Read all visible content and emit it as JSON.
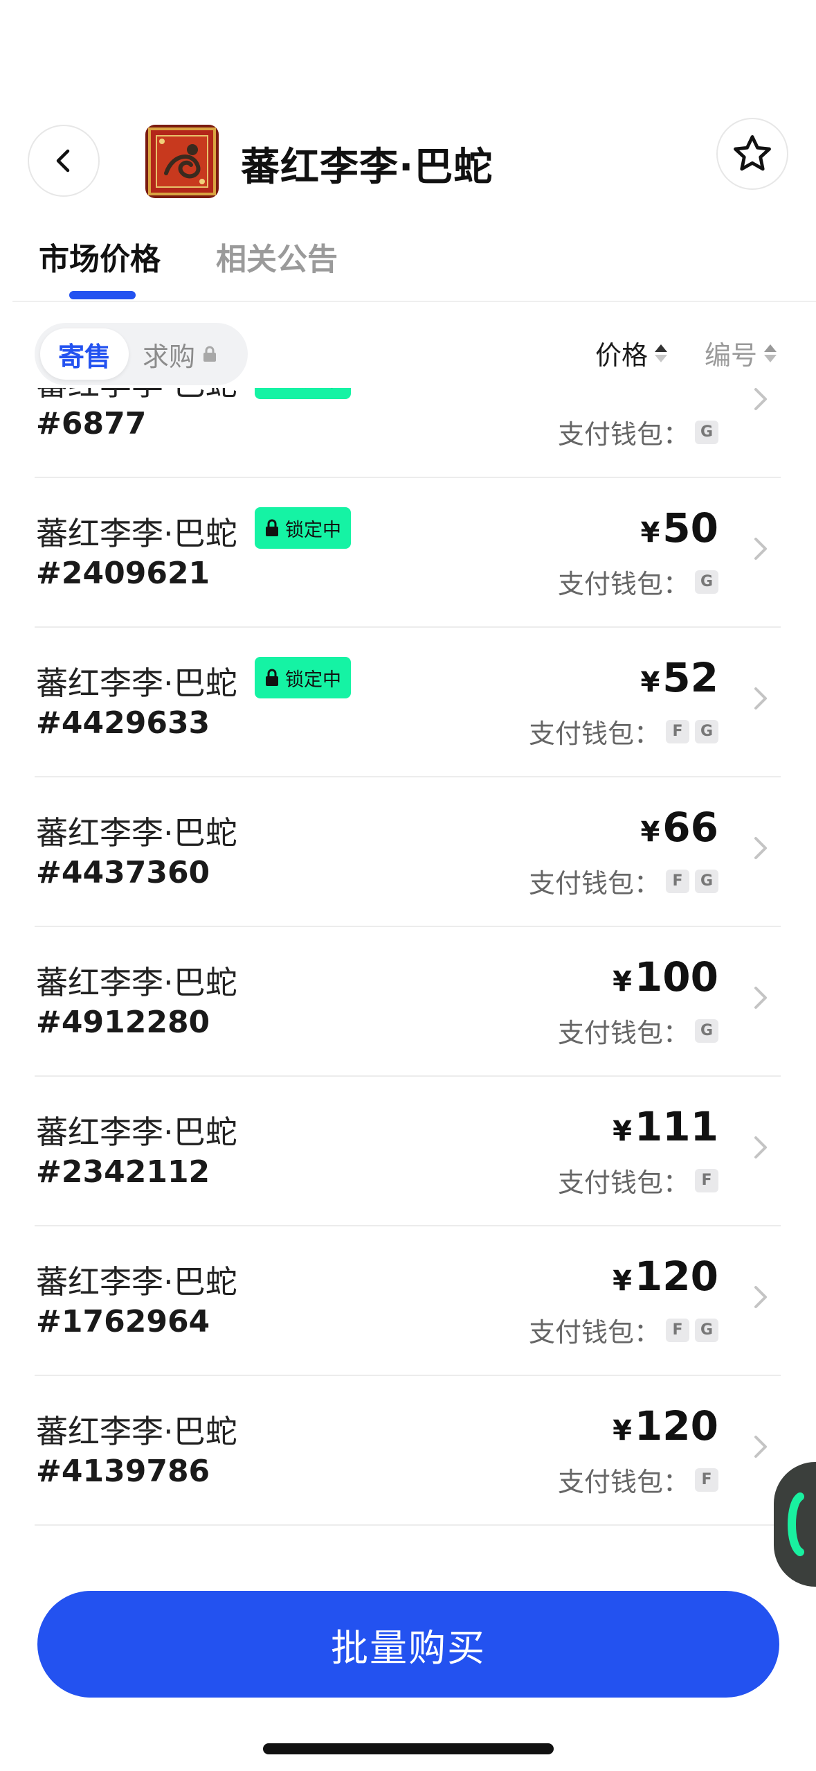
{
  "header": {
    "title": "蕃红李李·巴蛇"
  },
  "tabs": [
    {
      "label": "市场价格",
      "active": true
    },
    {
      "label": "相关公告",
      "active": false
    }
  ],
  "filter": {
    "segment_on": "寄售",
    "segment_off": "求购",
    "sort_price": "价格",
    "sort_number": "编号"
  },
  "wallet_label": "支付钱包：",
  "lock_label": "锁定中",
  "items": [
    {
      "name": "蕃红李李·巴蛇",
      "id": "#6877",
      "price": "",
      "locked": true,
      "wallets": [
        "G"
      ]
    },
    {
      "name": "蕃红李李·巴蛇",
      "id": "#2409621",
      "price": "50",
      "locked": true,
      "wallets": [
        "G"
      ]
    },
    {
      "name": "蕃红李李·巴蛇",
      "id": "#4429633",
      "price": "52",
      "locked": true,
      "wallets": [
        "F",
        "G"
      ]
    },
    {
      "name": "蕃红李李·巴蛇",
      "id": "#4437360",
      "price": "66",
      "locked": false,
      "wallets": [
        "F",
        "G"
      ]
    },
    {
      "name": "蕃红李李·巴蛇",
      "id": "#4912280",
      "price": "100",
      "locked": false,
      "wallets": [
        "G"
      ]
    },
    {
      "name": "蕃红李李·巴蛇",
      "id": "#2342112",
      "price": "111",
      "locked": false,
      "wallets": [
        "F"
      ]
    },
    {
      "name": "蕃红李李·巴蛇",
      "id": "#1762964",
      "price": "120",
      "locked": false,
      "wallets": [
        "F",
        "G"
      ]
    },
    {
      "name": "蕃红李李·巴蛇",
      "id": "#4139786",
      "price": "120",
      "locked": false,
      "wallets": [
        "F"
      ]
    }
  ],
  "currency_symbol": "¥",
  "cta": {
    "label": "批量购买"
  },
  "colors": {
    "accent": "#2352f0",
    "lock_badge": "#15f3a4"
  }
}
